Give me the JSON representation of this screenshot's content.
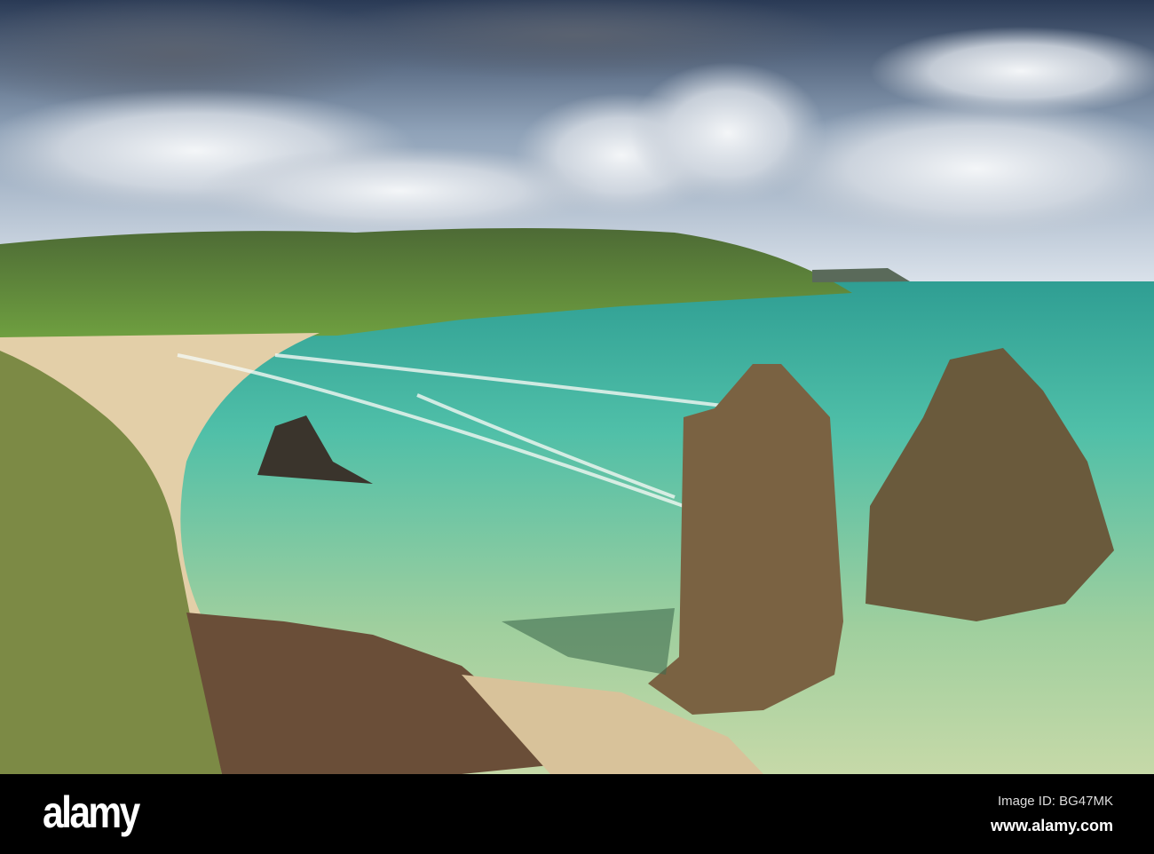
{
  "watermark": {
    "logo": "alamy"
  },
  "footer": {
    "image_id": "Image ID: BG47MK",
    "website": "www.alamy.com"
  }
}
